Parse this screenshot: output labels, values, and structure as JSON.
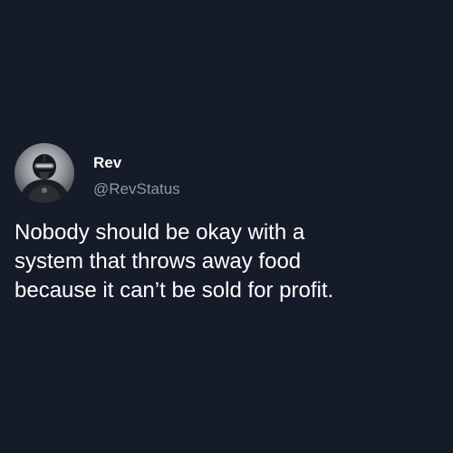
{
  "author": {
    "display_name": "Rev",
    "handle": "@RevStatus",
    "avatar_icon": "masked-figure-avatar-icon"
  },
  "tweet": {
    "lines": [
      "Nobody should be okay with a",
      "system that throws away food",
      "because it can’t be sold for profit."
    ]
  },
  "colors": {
    "background": "#151b29",
    "text": "#ffffff",
    "handle": "#8899a6"
  }
}
